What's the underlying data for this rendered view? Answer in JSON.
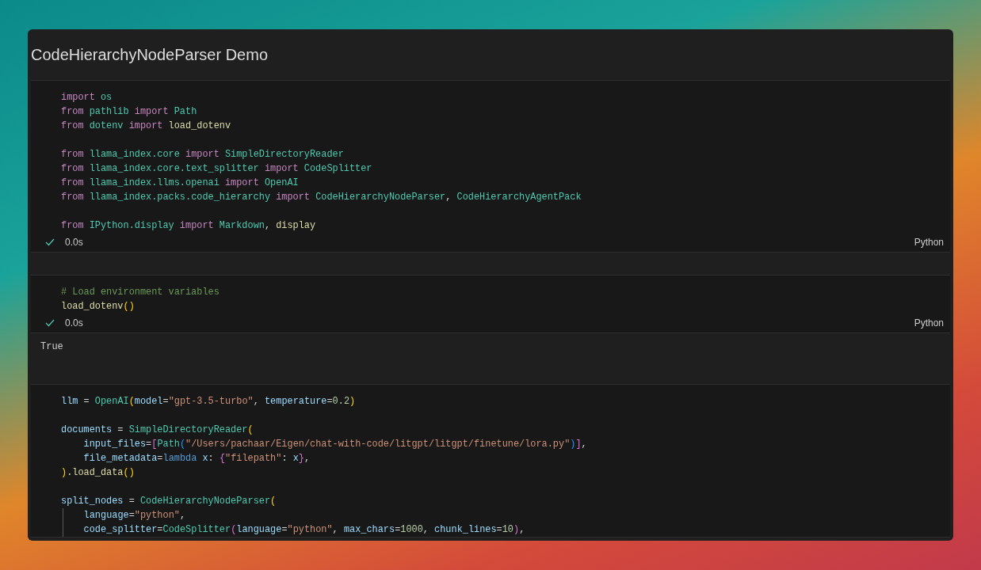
{
  "title": "CodeHierarchyNodeParser Demo",
  "cells": [
    {
      "blocks": [
        {
          "lines": [
            {
              "tokens": [
                {
                  "text": "import ",
                  "kind": "kw"
                },
                {
                  "text": "os",
                  "kind": "mod"
                }
              ]
            },
            {
              "tokens": [
                {
                  "text": "from ",
                  "kind": "kw"
                },
                {
                  "text": "pathlib ",
                  "kind": "mod"
                },
                {
                  "text": "import ",
                  "kind": "kw"
                },
                {
                  "text": "Path",
                  "kind": "mod"
                }
              ]
            },
            {
              "tokens": [
                {
                  "text": "from ",
                  "kind": "kw"
                },
                {
                  "text": "dotenv ",
                  "kind": "mod"
                },
                {
                  "text": "import ",
                  "kind": "kw"
                },
                {
                  "text": "load_dotenv",
                  "kind": "fn"
                }
              ]
            }
          ]
        },
        {
          "lines": [
            {
              "tokens": [
                {
                  "text": "from ",
                  "kind": "kw"
                },
                {
                  "text": "llama_index.core ",
                  "kind": "mod"
                },
                {
                  "text": "import ",
                  "kind": "kw"
                },
                {
                  "text": "SimpleDirectoryReader",
                  "kind": "mod"
                }
              ]
            },
            {
              "tokens": [
                {
                  "text": "from ",
                  "kind": "kw"
                },
                {
                  "text": "llama_index.core.text_splitter ",
                  "kind": "mod"
                },
                {
                  "text": "import ",
                  "kind": "kw"
                },
                {
                  "text": "CodeSplitter",
                  "kind": "mod"
                }
              ]
            },
            {
              "tokens": [
                {
                  "text": "from ",
                  "kind": "kw"
                },
                {
                  "text": "llama_index.llms.openai ",
                  "kind": "mod"
                },
                {
                  "text": "import ",
                  "kind": "kw"
                },
                {
                  "text": "OpenAI",
                  "kind": "mod"
                }
              ]
            },
            {
              "tokens": [
                {
                  "text": "from ",
                  "kind": "kw"
                },
                {
                  "text": "llama_index.packs.code_hierarchy ",
                  "kind": "mod"
                },
                {
                  "text": "import ",
                  "kind": "kw"
                },
                {
                  "text": "CodeHierarchyNodeParser",
                  "kind": "mod"
                },
                {
                  "text": ", ",
                  "kind": "plain"
                },
                {
                  "text": "CodeHierarchyAgentPack",
                  "kind": "mod"
                }
              ]
            }
          ]
        },
        {
          "lines": [
            {
              "tokens": [
                {
                  "text": "from ",
                  "kind": "kw"
                },
                {
                  "text": "IPython.display ",
                  "kind": "mod"
                },
                {
                  "text": "import ",
                  "kind": "kw"
                },
                {
                  "text": "Markdown",
                  "kind": "mod"
                },
                {
                  "text": ", ",
                  "kind": "plain"
                },
                {
                  "text": "display",
                  "kind": "fn"
                }
              ]
            }
          ]
        }
      ],
      "status": {
        "time": "0.0s",
        "language": "Python"
      }
    },
    {
      "blocks": [
        {
          "lines": [
            {
              "tokens": [
                {
                  "text": "# Load environment variables",
                  "kind": "comment"
                }
              ]
            },
            {
              "tokens": [
                {
                  "text": "load_dotenv",
                  "kind": "fn"
                },
                {
                  "text": "()",
                  "kind": "paren"
                }
              ]
            }
          ]
        }
      ],
      "status": {
        "time": "0.0s",
        "language": "Python"
      },
      "output": "True"
    },
    {
      "blocks": [
        {
          "lines": [
            {
              "tokens": [
                {
                  "text": "llm",
                  "kind": "var"
                },
                {
                  "text": " = ",
                  "kind": "plain"
                },
                {
                  "text": "OpenAI",
                  "kind": "mod"
                },
                {
                  "text": "(",
                  "kind": "paren"
                },
                {
                  "text": "model",
                  "kind": "var"
                },
                {
                  "text": "=",
                  "kind": "plain"
                },
                {
                  "text": "\"gpt-3.5-turbo\"",
                  "kind": "str"
                },
                {
                  "text": ", ",
                  "kind": "plain"
                },
                {
                  "text": "temperature",
                  "kind": "var"
                },
                {
                  "text": "=",
                  "kind": "plain"
                },
                {
                  "text": "0.2",
                  "kind": "num"
                },
                {
                  "text": ")",
                  "kind": "paren"
                }
              ]
            }
          ]
        },
        {
          "lines": [
            {
              "tokens": [
                {
                  "text": "documents",
                  "kind": "var"
                },
                {
                  "text": " = ",
                  "kind": "plain"
                },
                {
                  "text": "SimpleDirectoryReader",
                  "kind": "mod"
                },
                {
                  "text": "(",
                  "kind": "paren"
                }
              ]
            },
            {
              "indented": true,
              "tokens": [
                {
                  "text": "input_files",
                  "kind": "var"
                },
                {
                  "text": "=",
                  "kind": "plain"
                },
                {
                  "text": "[",
                  "kind": "bracket"
                },
                {
                  "text": "Path",
                  "kind": "mod"
                },
                {
                  "text": "(",
                  "kind": "bracket2"
                },
                {
                  "text": "\"/Users/pachaar/Eigen/chat-with-code/litgpt/litgpt/finetune/lora.py\"",
                  "kind": "str"
                },
                {
                  "text": ")",
                  "kind": "bracket2"
                },
                {
                  "text": "]",
                  "kind": "bracket"
                },
                {
                  "text": ",",
                  "kind": "plain"
                }
              ]
            },
            {
              "indented": true,
              "tokens": [
                {
                  "text": "file_metadata",
                  "kind": "var"
                },
                {
                  "text": "=",
                  "kind": "plain"
                },
                {
                  "text": "lambda ",
                  "kind": "lambda"
                },
                {
                  "text": "x",
                  "kind": "var"
                },
                {
                  "text": ": ",
                  "kind": "plain"
                },
                {
                  "text": "{",
                  "kind": "bracket"
                },
                {
                  "text": "\"filepath\"",
                  "kind": "str"
                },
                {
                  "text": ": ",
                  "kind": "plain"
                },
                {
                  "text": "x",
                  "kind": "var"
                },
                {
                  "text": "}",
                  "kind": "bracket"
                },
                {
                  "text": ",",
                  "kind": "plain"
                }
              ]
            },
            {
              "tokens": [
                {
                  "text": ")",
                  "kind": "paren"
                },
                {
                  "text": ".load_data",
                  "kind": "fn"
                },
                {
                  "text": "()",
                  "kind": "paren"
                }
              ]
            }
          ]
        },
        {
          "lines": [
            {
              "tokens": [
                {
                  "text": "split_nodes",
                  "kind": "var"
                },
                {
                  "text": " = ",
                  "kind": "plain"
                },
                {
                  "text": "CodeHierarchyNodeParser",
                  "kind": "mod"
                },
                {
                  "text": "(",
                  "kind": "paren"
                }
              ]
            },
            {
              "indented": true,
              "guide": true,
              "tokens": [
                {
                  "text": "language",
                  "kind": "var"
                },
                {
                  "text": "=",
                  "kind": "plain"
                },
                {
                  "text": "\"python\"",
                  "kind": "str"
                },
                {
                  "text": ",",
                  "kind": "plain"
                }
              ]
            },
            {
              "indented": true,
              "guide": true,
              "tokens": [
                {
                  "text": "code_splitter",
                  "kind": "var"
                },
                {
                  "text": "=",
                  "kind": "plain"
                },
                {
                  "text": "CodeSplitter",
                  "kind": "mod"
                },
                {
                  "text": "(",
                  "kind": "bracket"
                },
                {
                  "text": "language",
                  "kind": "var"
                },
                {
                  "text": "=",
                  "kind": "plain"
                },
                {
                  "text": "\"python\"",
                  "kind": "str"
                },
                {
                  "text": ", ",
                  "kind": "plain"
                },
                {
                  "text": "max_chars",
                  "kind": "var"
                },
                {
                  "text": "=",
                  "kind": "plain"
                },
                {
                  "text": "1000",
                  "kind": "num"
                },
                {
                  "text": ", ",
                  "kind": "plain"
                },
                {
                  "text": "chunk_lines",
                  "kind": "var"
                },
                {
                  "text": "=",
                  "kind": "plain"
                },
                {
                  "text": "10",
                  "kind": "num"
                },
                {
                  "text": ")",
                  "kind": "bracket"
                },
                {
                  "text": ",",
                  "kind": "plain"
                }
              ]
            }
          ]
        }
      ]
    }
  ]
}
